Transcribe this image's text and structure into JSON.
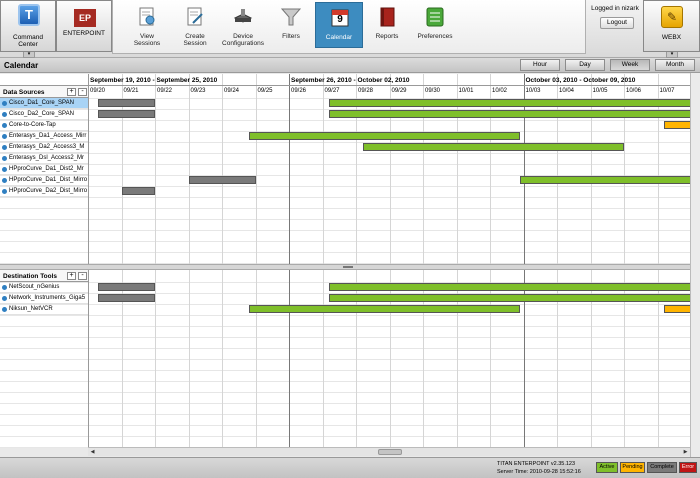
{
  "toolbar": {
    "command_center": {
      "icon_letter": "T",
      "label_line1": "Command",
      "label_line2": "Center"
    },
    "enterpoint": {
      "icon_text": "EP",
      "label": "ENTERPOINT"
    },
    "nav_items": [
      {
        "label_line1": "View",
        "label_line2": "Sessions",
        "icon": "view-sessions-icon"
      },
      {
        "label_line1": "Create",
        "label_line2": "Session",
        "icon": "create-session-icon"
      },
      {
        "label_line1": "Device",
        "label_line2": "Configurations",
        "icon": "device-icon"
      },
      {
        "label_line1": "Filters",
        "label_line2": "",
        "icon": "filter-icon"
      },
      {
        "label_line1": "Calendar",
        "label_line2": "",
        "icon": "calendar-icon",
        "icon_text": "9"
      },
      {
        "label_line1": "Reports",
        "label_line2": "",
        "icon": "reports-icon"
      },
      {
        "label_line1": "Preferences",
        "label_line2": "",
        "icon": "preferences-icon"
      }
    ],
    "login_text": "Logged in nizark",
    "logout_label": "Logout",
    "webx": {
      "icon_text": "✎",
      "label": "WEBX"
    }
  },
  "page": {
    "title": "Calendar",
    "views": [
      "Hour",
      "Day",
      "Week",
      "Month"
    ],
    "active_view": "Week"
  },
  "weeks": [
    "September 19, 2010 - September 25, 2010",
    "September 26, 2010 - October 02, 2010",
    "October 03, 2010 - October 09, 2010"
  ],
  "dates": [
    "09/20",
    "09/21",
    "09/22",
    "09/23",
    "09/24",
    "09/25",
    "09/26",
    "09/27",
    "09/28",
    "09/29",
    "09/30",
    "10/01",
    "10/02",
    "10/03",
    "10/04",
    "10/05",
    "10/06",
    "10/07"
  ],
  "data_sources": {
    "header": "Data Sources",
    "plus": "+",
    "minus": "-",
    "rows": [
      {
        "label": "Cisco_Da1_Core_SPAN",
        "selected": true
      },
      {
        "label": "Cisco_Da2_Core_SPAN"
      },
      {
        "label": "Core-to-Core-Tap"
      },
      {
        "label": "Enterasys_Da1_Access_Mirr"
      },
      {
        "label": "Enterasys_Da2_Access3_M"
      },
      {
        "label": "Enterasys_Dsl_Access2_Mr"
      },
      {
        "label": "HPproCurve_Da1_Dist2_Mr"
      },
      {
        "label": "HPproCurve_Da1_Dist_Mirro"
      },
      {
        "label": "HPproCurve_Da2_Dist_Mirro"
      }
    ],
    "bars": [
      {
        "row": 0,
        "start": 0.3,
        "end": 2.0,
        "status": "complete"
      },
      {
        "row": 0,
        "start": 7.2,
        "end": 18.0,
        "status": "active"
      },
      {
        "row": 1,
        "start": 0.3,
        "end": 2.0,
        "status": "complete"
      },
      {
        "row": 1,
        "start": 7.2,
        "end": 18.0,
        "status": "active"
      },
      {
        "row": 2,
        "start": 17.2,
        "end": 18.0,
        "status": "pending"
      },
      {
        "row": 3,
        "start": 4.8,
        "end": 12.9,
        "status": "active"
      },
      {
        "row": 4,
        "start": 8.2,
        "end": 16.0,
        "status": "active"
      },
      {
        "row": 7,
        "start": 3.0,
        "end": 5.0,
        "status": "complete"
      },
      {
        "row": 7,
        "start": 12.9,
        "end": 18.0,
        "status": "active"
      },
      {
        "row": 8,
        "start": 1.0,
        "end": 2.0,
        "status": "complete"
      }
    ]
  },
  "destination_tools": {
    "header": "Destination Tools",
    "plus": "+",
    "minus": "-",
    "rows": [
      {
        "label": "NetScout_nGenius"
      },
      {
        "label": "Network_Instruments_Giga5"
      },
      {
        "label": "Niksun_NetVCR"
      }
    ],
    "bars": [
      {
        "row": 0,
        "start": 0.3,
        "end": 2.0,
        "status": "complete"
      },
      {
        "row": 0,
        "start": 7.2,
        "end": 18.0,
        "status": "active"
      },
      {
        "row": 1,
        "start": 0.3,
        "end": 2.0,
        "status": "complete"
      },
      {
        "row": 1,
        "start": 7.2,
        "end": 18.0,
        "status": "active"
      },
      {
        "row": 2,
        "start": 4.8,
        "end": 12.9,
        "status": "active"
      },
      {
        "row": 2,
        "start": 17.2,
        "end": 18.0,
        "status": "pending"
      }
    ]
  },
  "status_colors": {
    "active": "#7fbf2a",
    "pending": "#ffb400",
    "complete": "#7a7a7a",
    "error": "#c01515"
  },
  "statusbar": {
    "version": "TITAN ENTERPOINT  v2.35.123",
    "server_time": "Server Time:  2010-09-28 15:52:16",
    "legend": [
      {
        "label": "Active",
        "status": "active"
      },
      {
        "label": "Pending",
        "status": "pending"
      },
      {
        "label": "Complete",
        "status": "complete"
      },
      {
        "label": "Error",
        "status": "error"
      }
    ]
  }
}
